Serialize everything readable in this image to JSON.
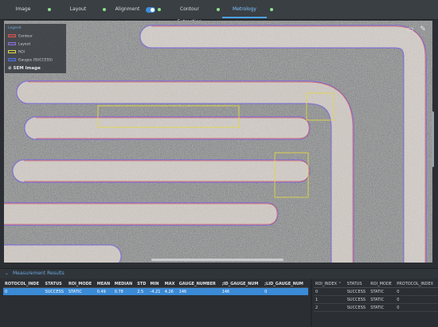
{
  "tabs": [
    {
      "label": "Image"
    },
    {
      "label": "Layout"
    },
    {
      "label": "Alignment"
    },
    {
      "label": "Contour Extraction"
    },
    {
      "label": "Metrology"
    }
  ],
  "legend": {
    "header": "Legend",
    "items": [
      {
        "label": "Contour",
        "color": "#d9534f"
      },
      {
        "label": "Layout",
        "color": "#8a6fd1"
      },
      {
        "label": "ROI",
        "color": "#e0d84a"
      },
      {
        "label": "Gauges (SUCCESS)",
        "color": "#4f6ee0"
      }
    ],
    "sem_label": "SEM Image"
  },
  "results": {
    "title": "Measurement Results",
    "columns": [
      "ROTOCOL_INDE",
      "STATUS",
      "ROI_MODE",
      "MEAN",
      "MEDIAN",
      "STD",
      "MIN",
      "MAX",
      "GAUGE_NUMBER",
      ";ID_GAUGE_NUM",
      ";LID_GAUGE_NUM"
    ],
    "rows": [
      [
        "0",
        "SUCCESS",
        "STATIC",
        "0.49",
        "0.78",
        "2.5",
        "-4.21",
        "4.26",
        "146",
        "146",
        "0"
      ]
    ]
  },
  "roi_table": {
    "columns": [
      "ROI_INDEX",
      "STATUS",
      "ROI_MODE",
      "PROTOCOL_INDEX"
    ],
    "rows": [
      [
        "0",
        "SUCCESS",
        "STATIC",
        "0"
      ],
      [
        "1",
        "SUCCESS",
        "STATIC",
        "0"
      ],
      [
        "2",
        "SUCCESS",
        "STATIC",
        "0"
      ]
    ]
  },
  "icons": {
    "toolbar": [
      "comment-icon",
      "pencil-icon"
    ]
  }
}
